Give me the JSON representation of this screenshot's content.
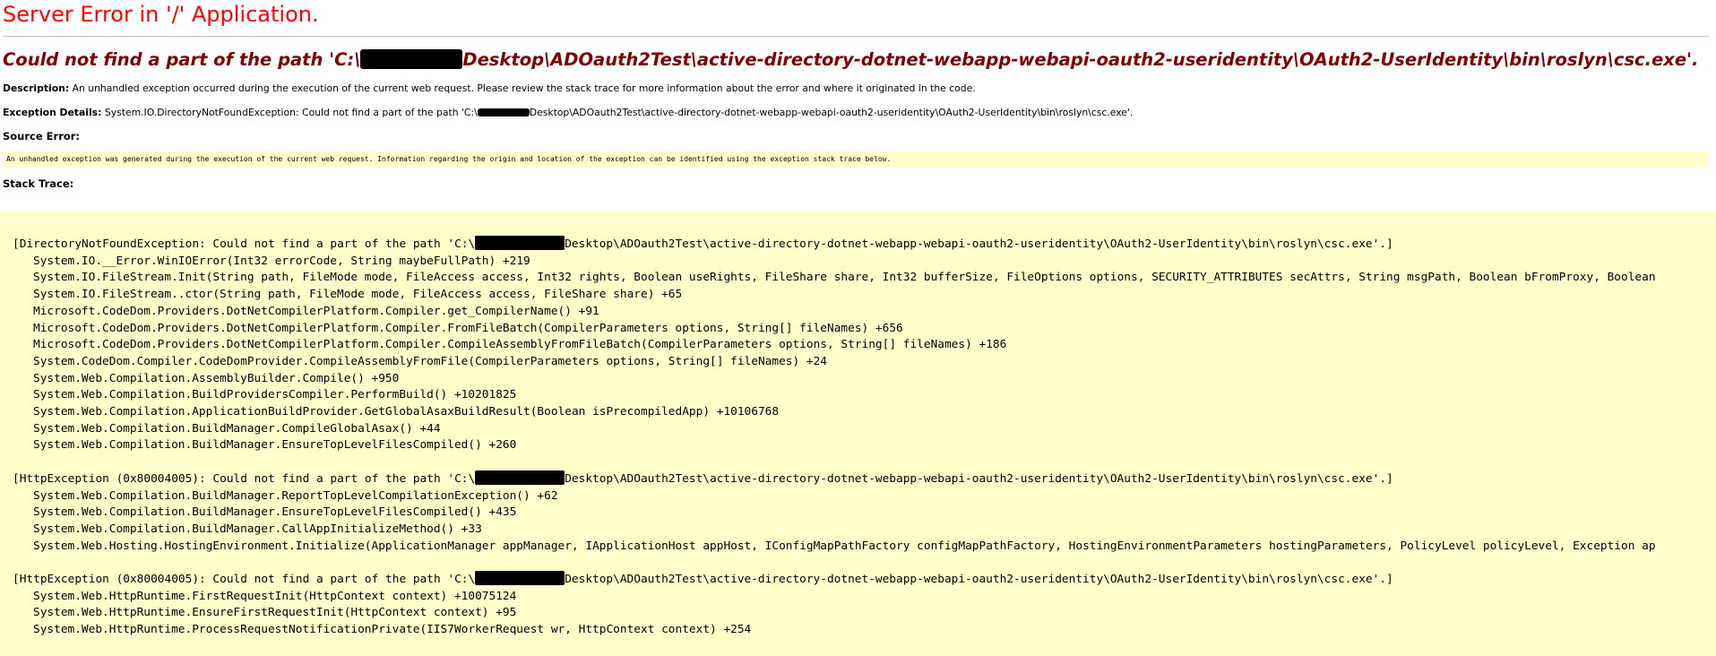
{
  "heading": "Server Error in '/' Application.",
  "error_title": {
    "prefix": "Could not find a part of the path 'C:\\",
    "suffix": "Desktop\\ADOauth2Test\\active-directory-dotnet-webapp-webapi-oauth2-useridentity\\OAuth2-UserIdentity\\bin\\roslyn\\csc.exe'."
  },
  "description": {
    "label": "Description:",
    "text": " An unhandled exception occurred during the execution of the current web request. Please review the stack trace for more information about the error and where it originated in the code."
  },
  "exception_details": {
    "label": "Exception Details:",
    "prefix": " System.IO.DirectoryNotFoundException: Could not find a part of the path 'C:\\",
    "suffix": "Desktop\\ADOauth2Test\\active-directory-dotnet-webapp-webapi-oauth2-useridentity\\OAuth2-UserIdentity\\bin\\roslyn\\csc.exe'."
  },
  "source_error": {
    "label": "Source Error:",
    "text": "An unhandled exception was generated during the execution of the current web request. Information regarding the origin and location of the exception can be identified using the exception stack trace below."
  },
  "stack_trace": {
    "label": "Stack Trace:",
    "blocks": [
      {
        "head_prefix": "[DirectoryNotFoundException: Could not find a part of the path 'C:\\",
        "head_suffix": "Desktop\\ADOauth2Test\\active-directory-dotnet-webapp-webapi-oauth2-useridentity\\OAuth2-UserIdentity\\bin\\roslyn\\csc.exe'.]",
        "frames": [
          "System.IO.__Error.WinIOError(Int32 errorCode, String maybeFullPath) +219",
          "System.IO.FileStream.Init(String path, FileMode mode, FileAccess access, Int32 rights, Boolean useRights, FileShare share, Int32 bufferSize, FileOptions options, SECURITY_ATTRIBUTES secAttrs, String msgPath, Boolean bFromProxy, Boolean",
          "System.IO.FileStream..ctor(String path, FileMode mode, FileAccess access, FileShare share) +65",
          "Microsoft.CodeDom.Providers.DotNetCompilerPlatform.Compiler.get_CompilerName() +91",
          "Microsoft.CodeDom.Providers.DotNetCompilerPlatform.Compiler.FromFileBatch(CompilerParameters options, String[] fileNames) +656",
          "Microsoft.CodeDom.Providers.DotNetCompilerPlatform.Compiler.CompileAssemblyFromFileBatch(CompilerParameters options, String[] fileNames) +186",
          "System.CodeDom.Compiler.CodeDomProvider.CompileAssemblyFromFile(CompilerParameters options, String[] fileNames) +24",
          "System.Web.Compilation.AssemblyBuilder.Compile() +950",
          "System.Web.Compilation.BuildProvidersCompiler.PerformBuild() +10201825",
          "System.Web.Compilation.ApplicationBuildProvider.GetGlobalAsaxBuildResult(Boolean isPrecompiledApp) +10106768",
          "System.Web.Compilation.BuildManager.CompileGlobalAsax() +44",
          "System.Web.Compilation.BuildManager.EnsureTopLevelFilesCompiled() +260"
        ]
      },
      {
        "head_prefix": "[HttpException (0x80004005): Could not find a part of the path 'C:\\",
        "head_suffix": "Desktop\\ADOauth2Test\\active-directory-dotnet-webapp-webapi-oauth2-useridentity\\OAuth2-UserIdentity\\bin\\roslyn\\csc.exe'.]",
        "frames": [
          "System.Web.Compilation.BuildManager.ReportTopLevelCompilationException() +62",
          "System.Web.Compilation.BuildManager.EnsureTopLevelFilesCompiled() +435",
          "System.Web.Compilation.BuildManager.CallAppInitializeMethod() +33",
          "System.Web.Hosting.HostingEnvironment.Initialize(ApplicationManager appManager, IApplicationHost appHost, IConfigMapPathFactory configMapPathFactory, HostingEnvironmentParameters hostingParameters, PolicyLevel policyLevel, Exception ap"
        ]
      },
      {
        "head_prefix": "[HttpException (0x80004005): Could not find a part of the path 'C:\\",
        "head_suffix": "Desktop\\ADOauth2Test\\active-directory-dotnet-webapp-webapi-oauth2-useridentity\\OAuth2-UserIdentity\\bin\\roslyn\\csc.exe'.]",
        "frames": [
          "System.Web.HttpRuntime.FirstRequestInit(HttpContext context) +10075124",
          "System.Web.HttpRuntime.EnsureFirstRequestInit(HttpContext context) +95",
          "System.Web.HttpRuntime.ProcessRequestNotificationPrivate(IIS7WorkerRequest wr, HttpContext context) +254"
        ]
      }
    ]
  },
  "colors": {
    "heading": "#ff0000",
    "error_title": "#800000",
    "code_background": "#ffffcc",
    "redaction": "#000000"
  }
}
